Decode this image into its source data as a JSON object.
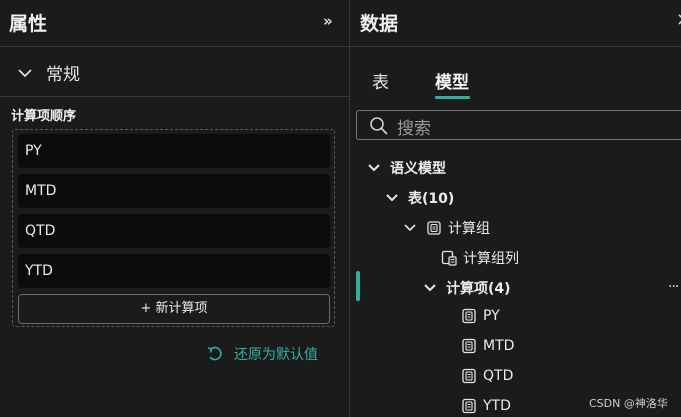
{
  "properties_pane": {
    "title": "属性",
    "collapse_icon": "»",
    "section": {
      "label": "常规"
    },
    "calc_order": {
      "title": "计算项顺序",
      "items": [
        "PY",
        "MTD",
        "QTD",
        "YTD"
      ],
      "add_label": "+ 新计算项"
    },
    "reset_label": "还原为默认值"
  },
  "data_pane": {
    "title": "数据",
    "close_icon": "×",
    "tabs": [
      {
        "label": "表",
        "active": false
      },
      {
        "label": "模型",
        "active": true
      }
    ],
    "search": {
      "placeholder": "搜索"
    },
    "tree": [
      {
        "label": "语义模型",
        "level": 0,
        "expanded": true,
        "icon": null
      },
      {
        "label": "表(10)",
        "level": 1,
        "expanded": true,
        "icon": null
      },
      {
        "label": "计算组",
        "level": 2,
        "expanded": true,
        "icon": "calc-group-icon"
      },
      {
        "label": "计算组列",
        "level": 3,
        "expanded": null,
        "icon": "calc-column-icon"
      },
      {
        "label": "计算项(4)",
        "level": 3,
        "expanded": true,
        "icon": null,
        "selected": true
      },
      {
        "label": "PY",
        "level": 4,
        "icon": "calc-item-icon"
      },
      {
        "label": "MTD",
        "level": 4,
        "icon": "calc-item-icon"
      },
      {
        "label": "QTD",
        "level": 4,
        "icon": "calc-item-icon"
      },
      {
        "label": "YTD",
        "level": 4,
        "icon": "calc-item-icon"
      }
    ],
    "more_icon": "···"
  },
  "watermark": "CSDN @神洛华",
  "colors": {
    "accent": "#32b09e",
    "background": "#1b1b1b",
    "item_bg": "#0b0b0b"
  }
}
